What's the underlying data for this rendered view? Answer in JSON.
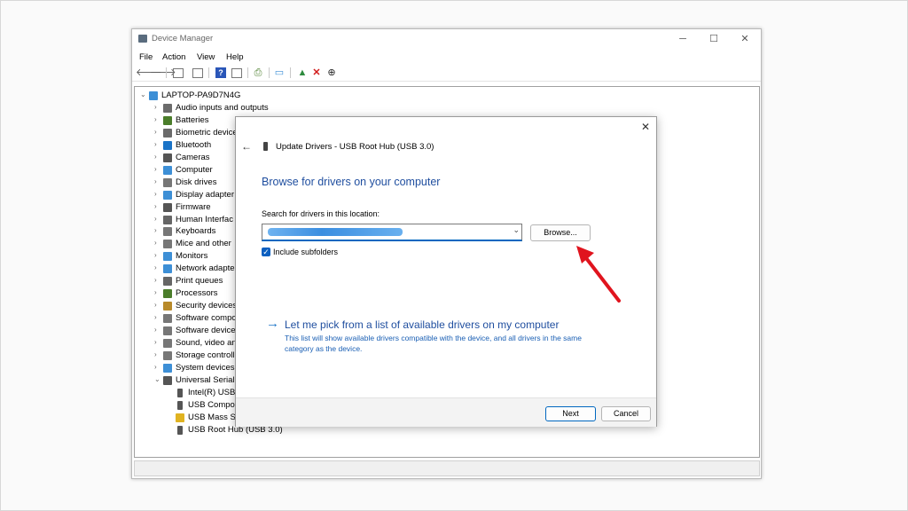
{
  "window": {
    "title": "Device Manager",
    "controls": {
      "minimize": "─",
      "maximize": "☐",
      "close": "✕"
    }
  },
  "menu": [
    "File",
    "Action",
    "View",
    "Help"
  ],
  "tree": {
    "root": "LAPTOP-PA9D7N4G",
    "categories": [
      {
        "label": "Audio inputs and outputs",
        "icon": "speaker-icon",
        "color": "#6b6b6b"
      },
      {
        "label": "Batteries",
        "icon": "battery-icon",
        "color": "#4a7d2a"
      },
      {
        "label": "Biometric device",
        "icon": "biometric-icon",
        "color": "#6b6b6b"
      },
      {
        "label": "Bluetooth",
        "icon": "bluetooth-icon",
        "color": "#1a73c7"
      },
      {
        "label": "Cameras",
        "icon": "camera-icon",
        "color": "#555555"
      },
      {
        "label": "Computer",
        "icon": "computer-icon",
        "color": "#3d8fd6"
      },
      {
        "label": "Disk drives",
        "icon": "disk-icon",
        "color": "#777777"
      },
      {
        "label": "Display adapter",
        "icon": "display-icon",
        "color": "#3d8fd6"
      },
      {
        "label": "Firmware",
        "icon": "firmware-icon",
        "color": "#555555"
      },
      {
        "label": "Human Interfac",
        "icon": "hid-icon",
        "color": "#666666"
      },
      {
        "label": "Keyboards",
        "icon": "keyboard-icon",
        "color": "#777777"
      },
      {
        "label": "Mice and other",
        "icon": "mouse-icon",
        "color": "#777777"
      },
      {
        "label": "Monitors",
        "icon": "monitor-icon",
        "color": "#3d8fd6"
      },
      {
        "label": "Network adapte",
        "icon": "network-icon",
        "color": "#3d8fd6"
      },
      {
        "label": "Print queues",
        "icon": "printer-icon",
        "color": "#666666"
      },
      {
        "label": "Processors",
        "icon": "processor-icon",
        "color": "#4a7d2a"
      },
      {
        "label": "Security devices",
        "icon": "security-icon",
        "color": "#b88a2a"
      },
      {
        "label": "Software compo",
        "icon": "software-icon",
        "color": "#777777"
      },
      {
        "label": "Software device",
        "icon": "software-device-icon",
        "color": "#777777"
      },
      {
        "label": "Sound, video an",
        "icon": "sound-icon",
        "color": "#777777"
      },
      {
        "label": "Storage controll",
        "icon": "storage-icon",
        "color": "#777777"
      },
      {
        "label": "System devices",
        "icon": "system-icon",
        "color": "#3d8fd6"
      },
      {
        "label": "Universal Serial I",
        "icon": "usb-icon",
        "color": "#555555",
        "expanded": true
      }
    ],
    "usb_children": [
      {
        "label": "Intel(R) USB",
        "icon": "usb-device-icon"
      },
      {
        "label": "USB Compo",
        "icon": "usb-device-icon"
      },
      {
        "label": "USB Mass St",
        "icon": "usb-warning-icon"
      },
      {
        "label": "USB Root Hub (USB 3.0)",
        "icon": "usb-device-icon"
      }
    ]
  },
  "dialog": {
    "close": "✕",
    "back": "←",
    "header": "Update Drivers - USB Root Hub (USB 3.0)",
    "heading": "Browse for drivers on your computer",
    "search_label": "Search for drivers in this location:",
    "path_value": "",
    "browse_label": "Browse...",
    "include_subfolders": "Include subfolders",
    "include_subfolders_checked": true,
    "pick_title": "Let me pick from a list of available drivers on my computer",
    "pick_desc": "This list will show available drivers compatible with the device, and all drivers in the same category as the device.",
    "next_label": "Next",
    "cancel_label": "Cancel"
  },
  "colors": {
    "accent": "#0067c0",
    "link": "#1f4e9f",
    "annotation_arrow": "#e0141e"
  }
}
